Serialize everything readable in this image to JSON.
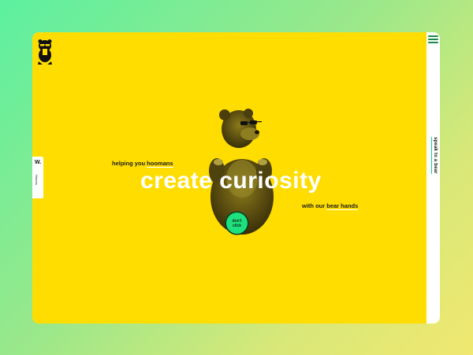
{
  "menu": {
    "icon": "hamburger-menu-icon"
  },
  "rail": {
    "label": "speak to a bear"
  },
  "logo": {
    "icon": "bear-sunglasses-logo-icon"
  },
  "left_tab": {
    "letter": "W.",
    "sub": "Honors"
  },
  "hero": {
    "tagline_prefix": "helping you ",
    "tagline_highlight": "hoomans",
    "headline": "create curiosity",
    "subline_prefix": "with our ",
    "subline_highlight": "bear hands",
    "button_line1": "don't",
    "button_line2": "click"
  },
  "colors": {
    "background": "#ffdd00",
    "accent_green": "#1fe07e",
    "headline": "#ffffff"
  }
}
